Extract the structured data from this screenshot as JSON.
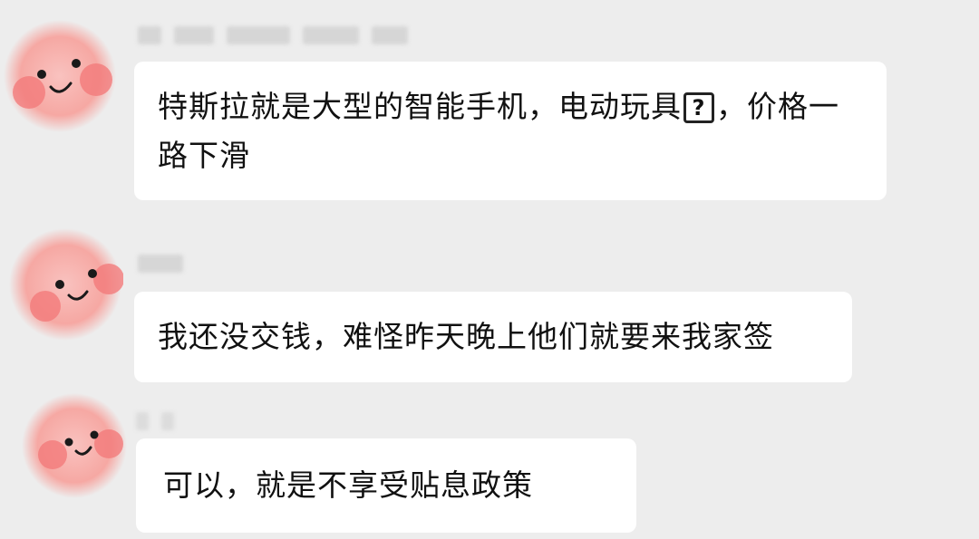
{
  "messages": [
    {
      "sender_name_visible": false,
      "text_before_icon": "特斯拉就是大型的智能手机，电动玩具",
      "icon": "unknown-character-box-icon",
      "icon_glyph": "?",
      "text_after_icon": "，价格一路下滑"
    },
    {
      "sender_name_visible": false,
      "text": "我还没交钱，难怪昨天晚上他们就要来我家签"
    },
    {
      "sender_name_visible": false,
      "text": "可以，就是不享受贴息政策"
    }
  ],
  "colors": {
    "background": "#ededed",
    "bubble": "#ffffff",
    "text": "#111111",
    "avatar_pink": "#f6a5a0",
    "avatar_cheek": "#f2797a"
  }
}
